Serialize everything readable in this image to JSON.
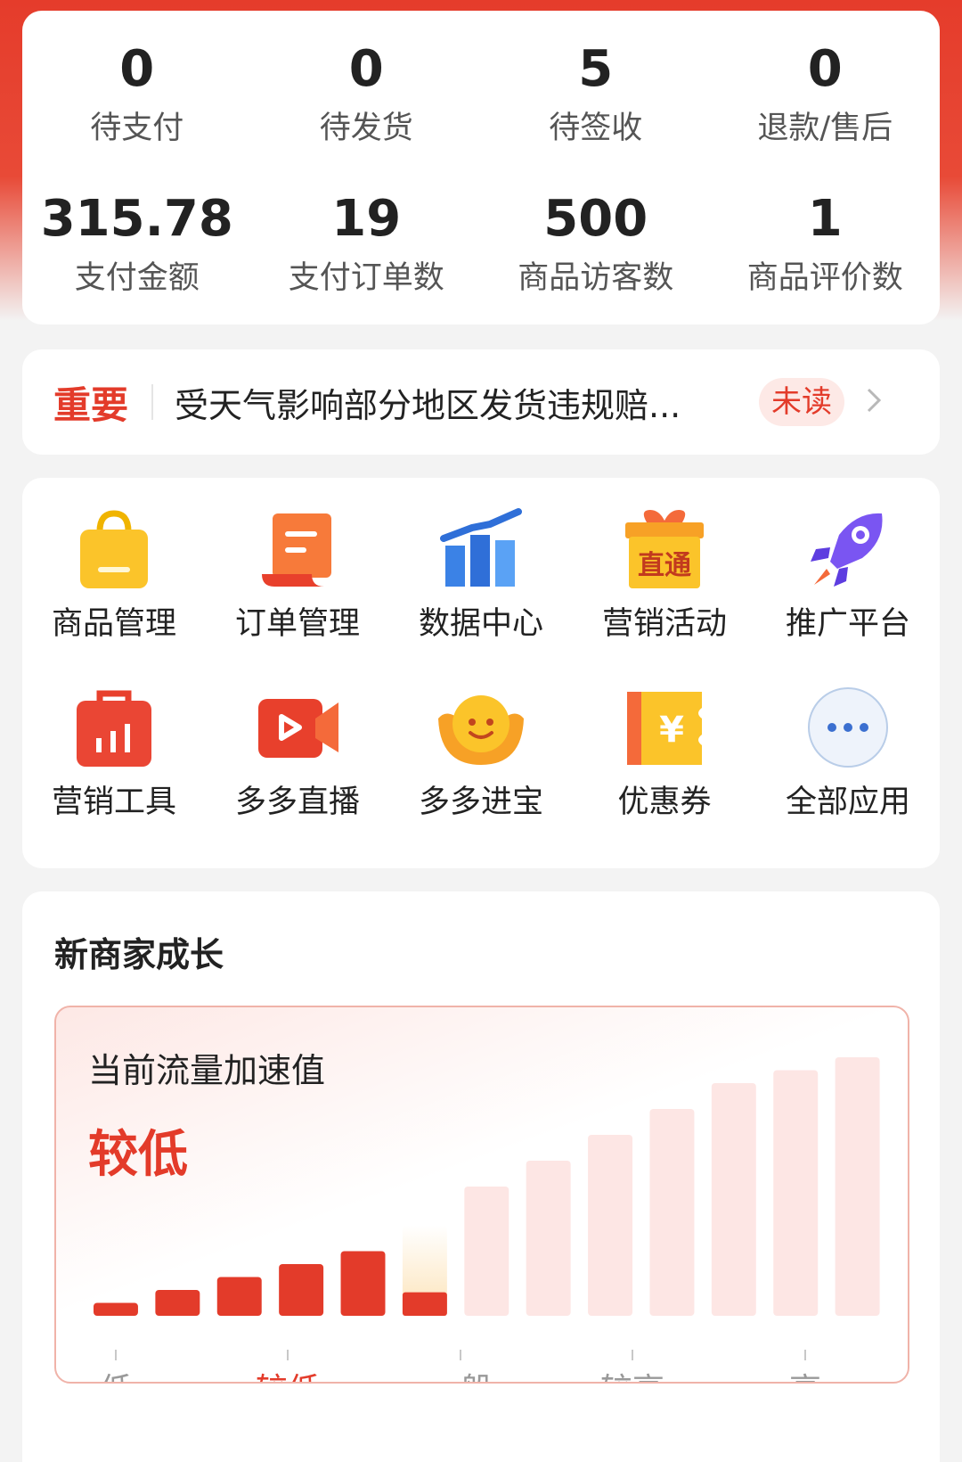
{
  "stats": {
    "row1": [
      {
        "value": "0",
        "label": "待支付"
      },
      {
        "value": "0",
        "label": "待发货"
      },
      {
        "value": "5",
        "label": "待签收"
      },
      {
        "value": "0",
        "label": "退款/售后"
      }
    ],
    "row2": [
      {
        "value": "315.78",
        "label": "支付金额"
      },
      {
        "value": "19",
        "label": "支付订单数"
      },
      {
        "value": "500",
        "label": "商品访客数"
      },
      {
        "value": "1",
        "label": "商品评价数"
      }
    ]
  },
  "notice": {
    "tag": "重要",
    "text": "受天气影响部分地区发货违规赔...",
    "badge": "未读",
    "arrow_icon": "chevron-right-icon"
  },
  "apps": {
    "row1": [
      {
        "label": "商品管理",
        "icon": "shopping-bag-icon"
      },
      {
        "label": "订单管理",
        "icon": "scroll-order-icon"
      },
      {
        "label": "数据中心",
        "icon": "bar-chart-icon"
      },
      {
        "label": "营销活动",
        "icon": "gift-box-icon",
        "icon_text": "直通"
      },
      {
        "label": "推广平台",
        "icon": "rocket-icon"
      }
    ],
    "row2": [
      {
        "label": "营销工具",
        "icon": "toolbox-icon"
      },
      {
        "label": "多多直播",
        "icon": "live-video-icon"
      },
      {
        "label": "多多进宝",
        "icon": "smiley-ingot-icon"
      },
      {
        "label": "优惠券",
        "icon": "coupon-icon",
        "icon_text": "¥"
      },
      {
        "label": "全部应用",
        "icon": "more-dots-icon"
      }
    ]
  },
  "growth": {
    "title": "新商家成长",
    "panel_title": "当前流量加速值",
    "level": "较低",
    "axis_labels": [
      "低",
      "较低",
      "一般",
      "较高",
      "高"
    ],
    "active_label_index": 1
  },
  "chart_data": {
    "type": "bar",
    "title": "当前流量加速值",
    "x_tick_labels": [
      "低",
      "较低",
      "一般",
      "较高",
      "高"
    ],
    "bar_count": 13,
    "filled_bars": 6,
    "current_level": "较低",
    "bar_heights_relative": [
      0.05,
      0.1,
      0.15,
      0.2,
      0.25,
      0.35,
      0.5,
      0.6,
      0.7,
      0.8,
      0.9,
      0.95,
      1.0
    ],
    "current_bar_fill_fraction": 0.26,
    "colors": {
      "filled": "#e33b2a",
      "empty": "#fde6e4",
      "current_glow": "#fce3b8"
    }
  },
  "colors": {
    "accent": "#e33b2a",
    "header_bg": "#e53c2b"
  }
}
